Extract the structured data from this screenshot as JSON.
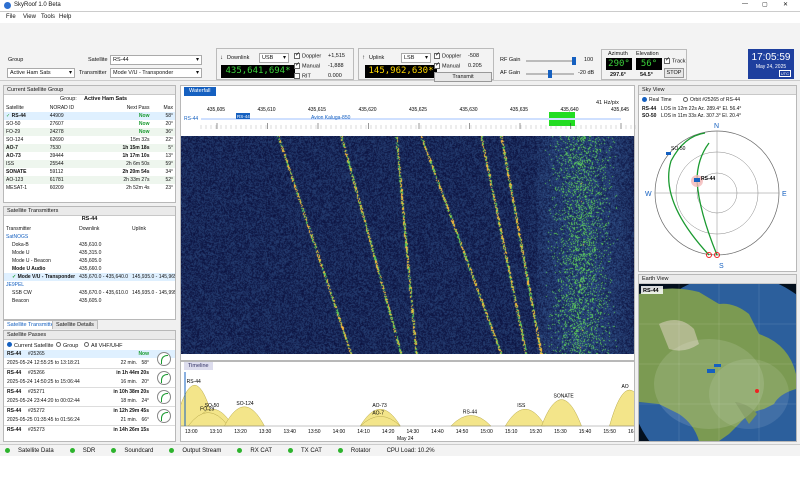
{
  "window": {
    "title": "SkyRoof 1.0 Beta",
    "controls": [
      "—",
      "▢",
      "✕"
    ]
  },
  "menu": [
    "File",
    "View",
    "Tools",
    "Help"
  ],
  "toolbar": {
    "group_label": "Group",
    "group_value": "Active Ham Sats",
    "satellite_label": "Satellite",
    "satellite_value": "RS-44",
    "transmitter_label": "Transmitter",
    "transmitter_value": "Mode V/U - Transponder",
    "downlink_label": "Downlink",
    "downlink_mode": "USB",
    "downlink_freq": "435,641,694*",
    "doppler_label": "Doppler",
    "doppler_value": "+1,515",
    "manual_label": "Manual",
    "manual_value": "-1,888",
    "rit_label": "RIT",
    "rit_value": "0.000",
    "uplink_label": "Uplink",
    "uplink_mode": "LSB",
    "uplink_freq": "145,962,630*",
    "up_doppler_label": "Doppler",
    "up_doppler_value": "-508",
    "up_manual_label": "Manual",
    "up_manual_value": "0.205",
    "transmit_label": "Transmit",
    "rf_gain_label": "RF Gain",
    "rf_gain_value": "100",
    "af_gain_label": "AF Gain",
    "af_gain_value": "-20 dB",
    "azimuth_label": "Azimuth",
    "azimuth_value": "290°",
    "az_sub": "297.6°",
    "elevation_label": "Elevation",
    "elevation_value": "56°",
    "el_sub": "54.5°",
    "track_label": "Track",
    "stop_label": "STOP",
    "clock_time": "17:05:59",
    "clock_date": "May 24, 2025",
    "clock_utc": "UTC"
  },
  "sat_group": {
    "title": "Current Satellite Group",
    "group_label": "Group:",
    "group_name": "Active Ham Sats",
    "columns": [
      "Satellite",
      "NORAD ID",
      "Next Pass",
      "Max"
    ],
    "rows": [
      {
        "name": "RS-44",
        "id": "44909",
        "next": "Now",
        "max": "58°",
        "sel": true
      },
      {
        "name": "SO-50",
        "id": "27607",
        "next": "Now",
        "max": "20°"
      },
      {
        "name": "FO-29",
        "id": "24278",
        "next": "Now",
        "max": "36°"
      },
      {
        "name": "SO-124",
        "id": "62690",
        "next": "15m 32s",
        "max": "22°"
      },
      {
        "name": "AO-7",
        "id": "7530",
        "next": "1h 15m 18s",
        "max": "5°",
        "bold": true
      },
      {
        "name": "AO-73",
        "id": "39444",
        "next": "1h 17m 10s",
        "max": "13°",
        "bold": true
      },
      {
        "name": "ISS",
        "id": "25544",
        "next": "2h 6m 50s",
        "max": "59°"
      },
      {
        "name": "SONATE",
        "id": "59112",
        "next": "2h 20m 54s",
        "max": "34°",
        "bold": true
      },
      {
        "name": "AO-123",
        "id": "61781",
        "next": "2h 33m 27s",
        "max": "52°"
      },
      {
        "name": "MESAT-1",
        "id": "60209",
        "next": "2h 52m 4s",
        "max": "23°"
      }
    ]
  },
  "transmitters": {
    "title": "Satellite Transmitters",
    "sat": "RS-44",
    "columns": [
      "Transmitter",
      "Downlink",
      "Uplink"
    ],
    "rows": [
      {
        "name": "SatNOGS",
        "group": true
      },
      {
        "name": "Doka-B",
        "down": "435,610.0",
        "up": ""
      },
      {
        "name": "Mode U",
        "down": "435,315.0",
        "up": ""
      },
      {
        "name": "Mode U - Beacon",
        "down": "435,605.0",
        "up": ""
      },
      {
        "name": "Mode U Audio",
        "down": "435,660.0",
        "up": "",
        "bold": true
      },
      {
        "name": "Mode V/U - Transponder",
        "down": "435,670.0 - 435,640.0",
        "up": "145,935.0 - 145,965.0",
        "bold": true,
        "sel": true
      },
      {
        "name": "JE9PEL",
        "group": true
      },
      {
        "name": "SSB CW",
        "down": "435,670.0 - 435,610.0",
        "up": "145,935.0 - 145,995.0"
      },
      {
        "name": "Beacon",
        "down": "435,605.0",
        "up": ""
      }
    ],
    "tabs": [
      "Satellite Transmitters",
      "Satellite Details"
    ]
  },
  "passes": {
    "title": "Satellite Passes",
    "radios": [
      "Current Satellite",
      "Group",
      "All VHF/UHF"
    ],
    "items": [
      {
        "sat": "RS-44",
        "id": "#25265",
        "when": "Now",
        "max": ""
      },
      {
        "range": "2025-05-24 12:55:25 to 13:18:21",
        "dur": "22 min.",
        "max": "58°"
      },
      {
        "sat": "RS-44",
        "id": "#25266",
        "when": "in 1h 44m 20s",
        "max": ""
      },
      {
        "range": "2025-05-24 14:50:25 to 15:06:44",
        "dur": "16 min.",
        "max": "20°"
      },
      {
        "sat": "RS-44",
        "id": "#25271",
        "when": "in 10h 38m 20s",
        "max": ""
      },
      {
        "range": "2025-05-24 23:44:20 to 00:02:44",
        "dur": "18 min.",
        "max": "24°"
      },
      {
        "sat": "RS-44",
        "id": "#25272",
        "when": "in 12h 29m 45s",
        "max": ""
      },
      {
        "range": "2025-05-25 01:35:45 to 01:56:24",
        "dur": "21 min.",
        "max": "66°"
      },
      {
        "sat": "RS-44",
        "id": "#25273",
        "when": "in 14h 26m 15s",
        "max": ""
      }
    ]
  },
  "waterfall": {
    "tab": "Waterfall",
    "scale": "41 Hz/pix",
    "ticks": [
      "435,605",
      "435,610",
      "435,615",
      "435,620",
      "435,625",
      "435,630",
      "435,635",
      "435,640",
      "435,645"
    ],
    "markers": [
      "RS-44",
      "RS-44",
      "Avion Kaluga-850"
    ]
  },
  "timeline": {
    "title": "Timeline",
    "date": "May 24",
    "times": [
      "13:00",
      "13:10",
      "13:20",
      "13:30",
      "13:40",
      "13:50",
      "14:00",
      "14:10",
      "14:20",
      "14:30",
      "14:40",
      "14:50",
      "15:00",
      "15:10",
      "15:20",
      "15:30",
      "15:40",
      "15:50",
      "16:00"
    ],
    "passes": [
      {
        "name": "RS-44",
        "at": 0.03,
        "h": 0.85
      },
      {
        "name": "SO-50",
        "at": 0.07,
        "h": 0.35
      },
      {
        "name": "FO-29",
        "at": 0.06,
        "h": 0.28
      },
      {
        "name": "SO-124",
        "at": 0.14,
        "h": 0.4
      },
      {
        "name": "AO-73",
        "at": 0.44,
        "h": 0.35
      },
      {
        "name": "AO-7",
        "at": 0.44,
        "h": 0.2
      },
      {
        "name": "RS-44",
        "at": 0.64,
        "h": 0.22
      },
      {
        "name": "ISS",
        "at": 0.76,
        "h": 0.35
      },
      {
        "name": "SONATE",
        "at": 0.84,
        "h": 0.55
      },
      {
        "name": "AO",
        "at": 0.99,
        "h": 0.75
      }
    ]
  },
  "skyview": {
    "title": "Sky View",
    "mode_rt": "Real Time",
    "mode_orbit": "Orbit #25265 of RS-44",
    "line1_sat": "RS-44",
    "line1": "LOS in 12m 22s Az. 289.4° El. 56.4°",
    "line2_sat": "SO-50",
    "line2": "LOS in 11m 33s Az. 307.3° El. 20.4°",
    "n": "N",
    "s": "S",
    "e": "E",
    "w": "W",
    "sat1": "RS-44",
    "sat2": "SO-50"
  },
  "earthview": {
    "title": "Earth View",
    "sat_label": "RS-44"
  },
  "status": {
    "items": [
      "Satellite Data",
      "SDR",
      "Soundcard",
      "Output Stream",
      "RX CAT",
      "TX CAT",
      "Rotator"
    ],
    "cpu": "CPU Load: 10.2%"
  },
  "colors": {
    "accent": "#1560c0",
    "lcd_green": "#3bd13b",
    "lcd_yellow": "#ffd800",
    "clock_bg": "#1e3f9e"
  }
}
